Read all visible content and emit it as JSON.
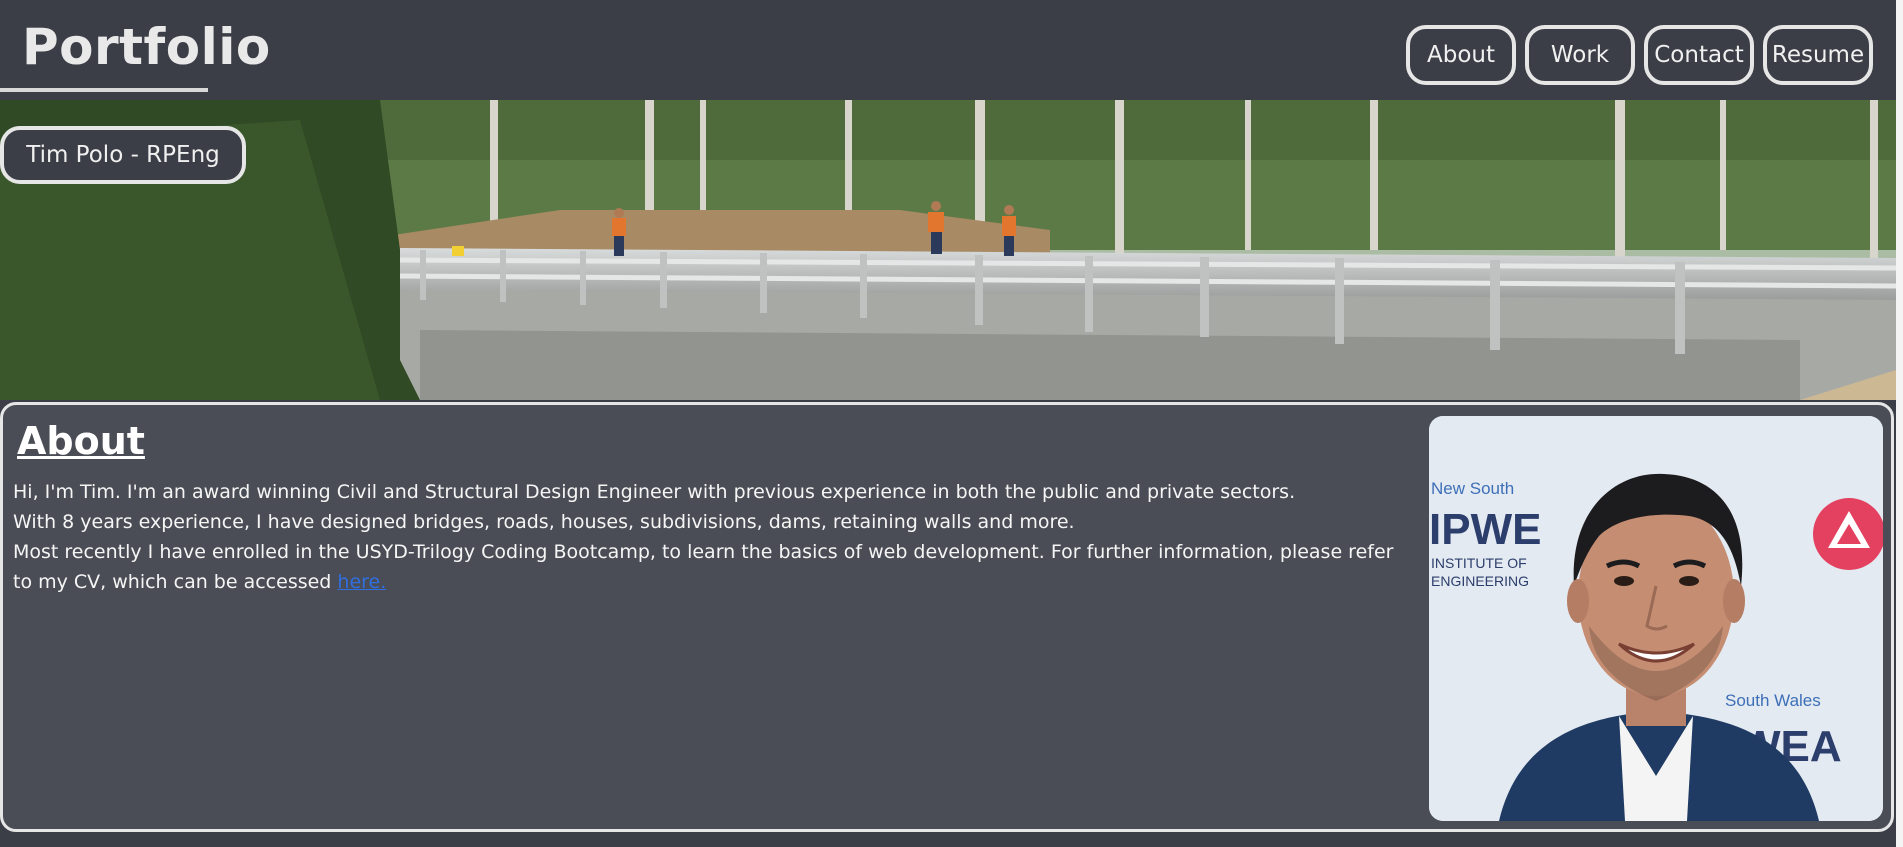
{
  "header": {
    "brand": "Portfolio",
    "nav": [
      {
        "label": "About"
      },
      {
        "label": "Work"
      },
      {
        "label": "Contact"
      },
      {
        "label": "Resume"
      }
    ]
  },
  "hero": {
    "name_badge": "Tim Polo - RPEng"
  },
  "about": {
    "title": "About",
    "line1": "Hi, I'm Tim. I'm an award winning Civil and Structural Design Engineer with previous experience in both the public and private sectors.",
    "line2": "With 8 years experience, I have designed bridges, roads, houses, subdivisions, dams, retaining walls and more.",
    "line3": "Most recently I have enrolled in the USYD-Trilogy Coding Bootcamp, to learn the basics of web development. For further information, please refer to my CV, which can be accessed ",
    "link_text": "here.",
    "portrait_logos": {
      "top_left_small": "New South",
      "big_left": "IPWE",
      "sub_left_1": "INSTITUTE OF",
      "sub_left_2": "ENGINEERING",
      "right_small": "South Wales",
      "big_right": "WEA"
    }
  },
  "colors": {
    "background": "#3b3e46",
    "card": "#4a4d55",
    "border": "#e6e6e6",
    "link": "#2f6fe0"
  }
}
